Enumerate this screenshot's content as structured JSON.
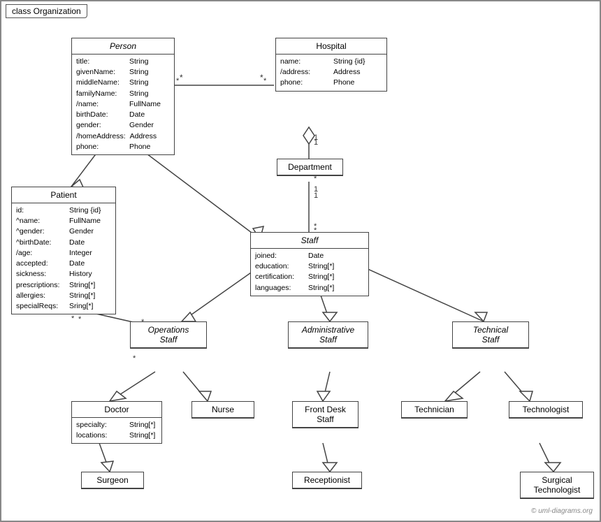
{
  "title": "class Organization",
  "copyright": "© uml-diagrams.org",
  "classes": {
    "person": {
      "name": "Person",
      "italic": true,
      "attrs": [
        {
          "name": "title:",
          "type": "String"
        },
        {
          "name": "givenName:",
          "type": "String"
        },
        {
          "name": "middleName:",
          "type": "String"
        },
        {
          "name": "familyName:",
          "type": "String"
        },
        {
          "name": "/name:",
          "type": "FullName"
        },
        {
          "name": "birthDate:",
          "type": "Date"
        },
        {
          "name": "gender:",
          "type": "Gender"
        },
        {
          "name": "/homeAddress:",
          "type": "Address"
        },
        {
          "name": "phone:",
          "type": "Phone"
        }
      ]
    },
    "hospital": {
      "name": "Hospital",
      "italic": false,
      "attrs": [
        {
          "name": "name:",
          "type": "String {id}"
        },
        {
          "name": "/address:",
          "type": "Address"
        },
        {
          "name": "phone:",
          "type": "Phone"
        }
      ]
    },
    "department": {
      "name": "Department",
      "italic": false,
      "attrs": []
    },
    "staff": {
      "name": "Staff",
      "italic": true,
      "attrs": [
        {
          "name": "joined:",
          "type": "Date"
        },
        {
          "name": "education:",
          "type": "String[*]"
        },
        {
          "name": "certification:",
          "type": "String[*]"
        },
        {
          "name": "languages:",
          "type": "String[*]"
        }
      ]
    },
    "patient": {
      "name": "Patient",
      "italic": false,
      "attrs": [
        {
          "name": "id:",
          "type": "String {id}"
        },
        {
          "name": "^name:",
          "type": "FullName"
        },
        {
          "name": "^gender:",
          "type": "Gender"
        },
        {
          "name": "^birthDate:",
          "type": "Date"
        },
        {
          "name": "/age:",
          "type": "Integer"
        },
        {
          "name": "accepted:",
          "type": "Date"
        },
        {
          "name": "sickness:",
          "type": "History"
        },
        {
          "name": "prescriptions:",
          "type": "String[*]"
        },
        {
          "name": "allergies:",
          "type": "String[*]"
        },
        {
          "name": "specialReqs:",
          "type": "Sring[*]"
        }
      ]
    },
    "operations_staff": {
      "name": "Operations\nStaff",
      "italic": true
    },
    "administrative_staff": {
      "name": "Administrative\nStaff",
      "italic": true
    },
    "technical_staff": {
      "name": "Technical\nStaff",
      "italic": true
    },
    "doctor": {
      "name": "Doctor",
      "attrs": [
        {
          "name": "specialty:",
          "type": "String[*]"
        },
        {
          "name": "locations:",
          "type": "String[*]"
        }
      ]
    },
    "nurse": {
      "name": "Nurse",
      "simple": true
    },
    "front_desk_staff": {
      "name": "Front Desk\nStaff",
      "simple": true
    },
    "technician": {
      "name": "Technician",
      "simple": true
    },
    "technologist": {
      "name": "Technologist",
      "simple": true
    },
    "surgeon": {
      "name": "Surgeon",
      "simple": true
    },
    "receptionist": {
      "name": "Receptionist",
      "simple": true
    },
    "surgical_technologist": {
      "name": "Surgical\nTechnologist",
      "simple": true
    }
  }
}
